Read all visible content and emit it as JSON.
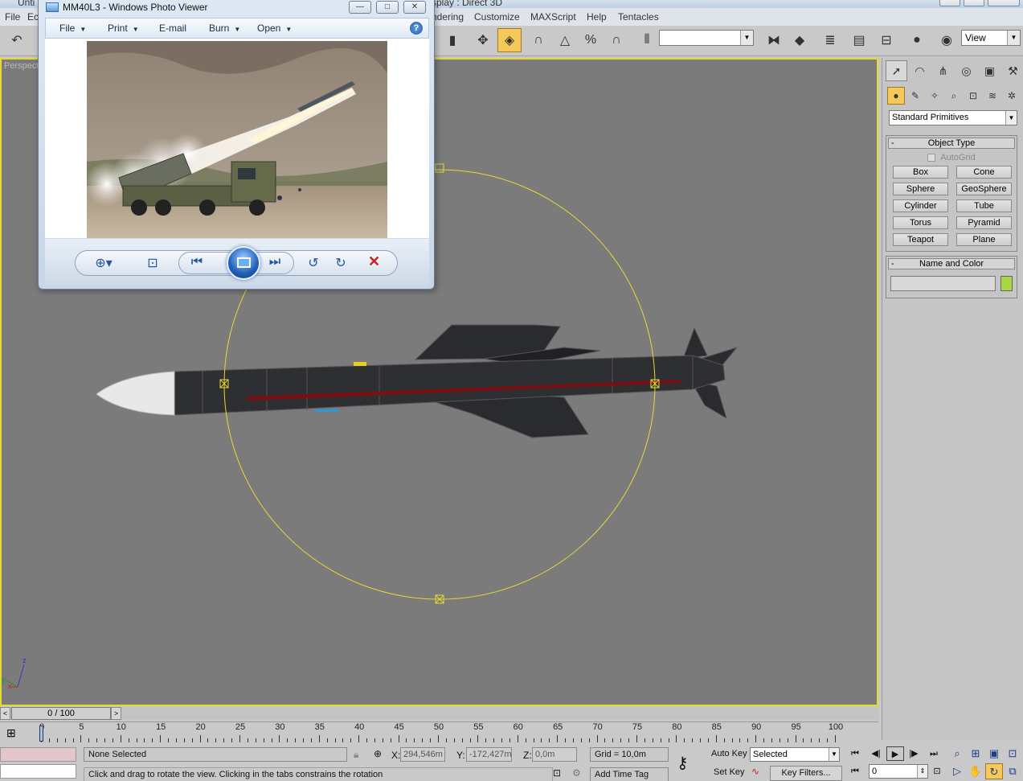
{
  "max": {
    "title_left": "Unti",
    "title_right": "splay : Direct 3D",
    "menu": [
      "File",
      "Ec",
      "ndering",
      "Customize",
      "MAXScript",
      "Help",
      "Tentacles"
    ],
    "toolbar": {
      "selection_set": "",
      "view_combo": "View"
    },
    "viewport": {
      "label": "Perspecti",
      "axis_x": "x",
      "axis_y": "y",
      "axis_z": "z"
    },
    "command_panel": {
      "category": "Standard Primitives",
      "object_type": {
        "header": "Object Type",
        "minus": "-",
        "autogrid": "AutoGrid",
        "buttons": [
          "Box",
          "Cone",
          "Sphere",
          "GeoSphere",
          "Cylinder",
          "Tube",
          "Torus",
          "Pyramid",
          "Teapot",
          "Plane"
        ]
      },
      "name_color": {
        "header": "Name and Color",
        "minus": "-",
        "name_value": "",
        "color": "#a8d846"
      }
    },
    "time_slider": {
      "position": "0 / 100",
      "left_arrow": "<",
      "right_arrow": ">"
    },
    "trackbar": {
      "ticks": [
        "0",
        "5",
        "10",
        "15",
        "20",
        "25",
        "30",
        "35",
        "40",
        "45",
        "50",
        "55",
        "60",
        "65",
        "70",
        "75",
        "80",
        "85",
        "90",
        "95",
        "100"
      ]
    },
    "status": {
      "selection": "None Selected",
      "prompt": "Click and drag to rotate the view.  Clicking in the tabs constrains the rotation",
      "x_label": "X:",
      "x_value": "294,546m",
      "y_label": "Y:",
      "y_value": "-172,427m",
      "z_label": "Z:",
      "z_value": "0,0m",
      "grid": "Grid = 10,0m",
      "add_time_tag": "Add Time Tag",
      "auto_key": "Auto Key",
      "set_key": "Set Key",
      "key_mode": "Selected",
      "key_filters": "Key Filters...",
      "frame": "0"
    }
  },
  "photo_viewer": {
    "title": "MM40L3 - Windows Photo Viewer",
    "menu": [
      "File",
      "Print",
      "E-mail",
      "Burn",
      "Open"
    ],
    "help": "?",
    "caption_min": "—",
    "caption_max": "□",
    "caption_close": "✕"
  },
  "colors": {
    "viewport_bg": "#7b7b7b",
    "selection_border": "#e8d832",
    "gizmo": "#e8d832",
    "missile_body": "#2e2f33",
    "stripe": "#7a0f14",
    "active_tool": "#f4c95a"
  }
}
